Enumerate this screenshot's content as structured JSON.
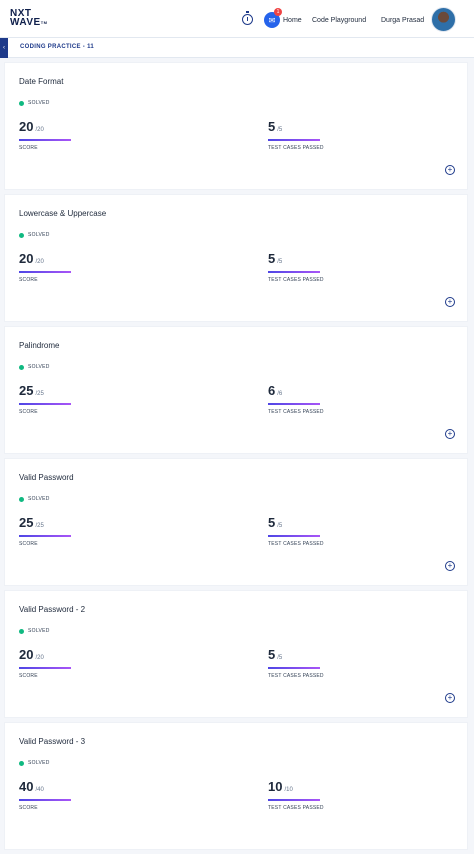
{
  "header": {
    "logo_line1": "NXT",
    "logo_line2": "WAVE",
    "logo_tm": "TM",
    "chat_badge": "1",
    "nav": {
      "home": "Home",
      "playground": "Code Playground",
      "user": "Durga Prasad"
    }
  },
  "breadcrumb": "CODING PRACTICE - 11",
  "problems": [
    {
      "title": "Date Format",
      "status": "SOLVED",
      "score": "20",
      "score_total": "/20",
      "score_label": "SCORE",
      "tests": "5",
      "tests_total": "/5",
      "tests_label": "TEST CASES PASSED"
    },
    {
      "title": "Lowercase & Uppercase",
      "status": "SOLVED",
      "score": "20",
      "score_total": "/20",
      "score_label": "SCORE",
      "tests": "5",
      "tests_total": "/5",
      "tests_label": "TEST CASES PASSED"
    },
    {
      "title": "Palindrome",
      "status": "SOLVED",
      "score": "25",
      "score_total": "/25",
      "score_label": "SCORE",
      "tests": "6",
      "tests_total": "/6",
      "tests_label": "TEST CASES PASSED"
    },
    {
      "title": "Valid Password",
      "status": "SOLVED",
      "score": "25",
      "score_total": "/25",
      "score_label": "SCORE",
      "tests": "5",
      "tests_total": "/5",
      "tests_label": "TEST CASES PASSED"
    },
    {
      "title": "Valid Password - 2",
      "status": "SOLVED",
      "score": "20",
      "score_total": "/20",
      "score_label": "SCORE",
      "tests": "5",
      "tests_total": "/5",
      "tests_label": "TEST CASES PASSED"
    },
    {
      "title": "Valid Password - 3",
      "status": "SOLVED",
      "score": "40",
      "score_total": "/40",
      "score_label": "SCORE",
      "tests": "10",
      "tests_total": "/10",
      "tests_label": "TEST CASES PASSED"
    }
  ],
  "colors": {
    "accent": "#1e3a8a",
    "solved": "#10b981",
    "bar_start": "#4f46e5",
    "bar_end": "#a855f7",
    "badge": "#ef4444"
  },
  "icons": {
    "timer": "stopwatch-icon",
    "chat": "chat-icon",
    "expand": "plus-circle-icon",
    "back": "chevron-left-icon"
  }
}
